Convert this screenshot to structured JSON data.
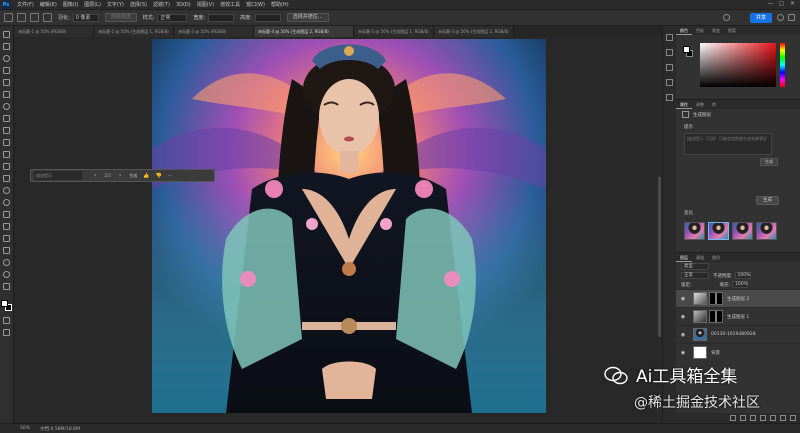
{
  "app": {
    "logo": "Ps"
  },
  "menubar": {
    "items": [
      "文件(F)",
      "编辑(E)",
      "图像(I)",
      "图层(L)",
      "文字(Y)",
      "选择(S)",
      "滤镜(T)",
      "3D(D)",
      "视图(V)",
      "增效工具",
      "窗口(W)",
      "帮助(H)"
    ],
    "win_controls": [
      "—",
      "▢",
      "✕"
    ]
  },
  "options": {
    "feather_label": "羽化:",
    "feather_value": "0 像素",
    "antialias_label": "消除锯齿",
    "style_label": "样式:",
    "style_value": "正常",
    "width_label": "宽度:",
    "height_label": "高度:",
    "select_subject": "选择并遮住...",
    "share": "共享"
  },
  "tabs": [
    {
      "label": "未标题-1 @ 50% (RGB/8)"
    },
    {
      "label": "未标题-2 @ 50% (生成图层 1, RGB/8)"
    },
    {
      "label": "未标题-3 @ 50% (RGB/8)"
    },
    {
      "label": "未标题-4 @ 50% (生成图层 2, RGB/8)"
    },
    {
      "label": "未标题-5 @ 50% (生成图层 1, RGB/8)"
    },
    {
      "label": "未标题-4 @ 50% (生成图层 2, RGB/8)"
    }
  ],
  "ctxbar": {
    "placeholder": "描述提示",
    "prev": "‹",
    "page": "2/3",
    "next": "›",
    "generate": "生成",
    "like": "👍",
    "dislike": "👎",
    "more": "···"
  },
  "color_panel": {
    "tabs": [
      "颜色",
      "色板",
      "渐变",
      "图案"
    ],
    "accent": "#e8141a"
  },
  "properties": {
    "tabs": [
      "属性",
      "调整",
      "库"
    ],
    "layer_name": "生成图层",
    "prompt_label": "提示",
    "prompt_placeholder": "描述提示（可选）可能会使图像生成效果更好",
    "generate_small": "生成",
    "generate": "生成",
    "variants_label": "变化",
    "variant_count": 3
  },
  "layers": {
    "tabs": [
      "图层",
      "通道",
      "路径"
    ],
    "kind_label": "类型",
    "blend": "正常",
    "opacity_label": "不透明度:",
    "opacity": "100%",
    "lock_label": "锁定:",
    "fill_label": "填充:",
    "fill": "100%",
    "items": [
      {
        "name": "生成图层 2",
        "active": true
      },
      {
        "name": "生成图层 1",
        "active": false
      },
      {
        "name": "00130-1019480928",
        "active": false
      },
      {
        "name": "背景",
        "active": false
      }
    ]
  },
  "status": {
    "zoom": "50%",
    "doc": "文档:4.58M/18.6M"
  },
  "watermark": {
    "title": "Ai工具箱全集",
    "subtitle": "@稀土掘金技术社区"
  }
}
